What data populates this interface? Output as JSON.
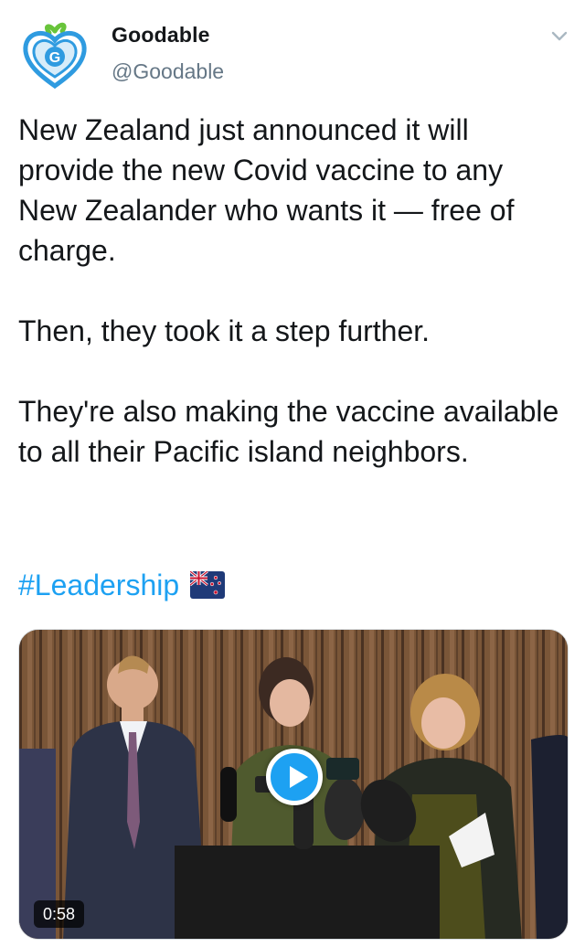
{
  "user": {
    "display_name": "Goodable",
    "handle": "@Goodable",
    "avatar_letter": "G"
  },
  "tweet": {
    "paragraphs": [
      "New Zealand just announced it will provide the new Covid vaccine to any New Zealander who wants it — free of charge.",
      "Then, they took it a step further.",
      "They're also making the vaccine available to all their Pacific island neighbors."
    ],
    "hashtag": "#Leadership",
    "emoji": "new-zealand-flag-icon"
  },
  "media": {
    "duration": "0:58",
    "type": "video"
  },
  "colors": {
    "link": "#1da1f2",
    "handle": "#657786",
    "text": "#14171a",
    "brand_blue": "#2f9be0",
    "brand_green": "#68c43a"
  }
}
